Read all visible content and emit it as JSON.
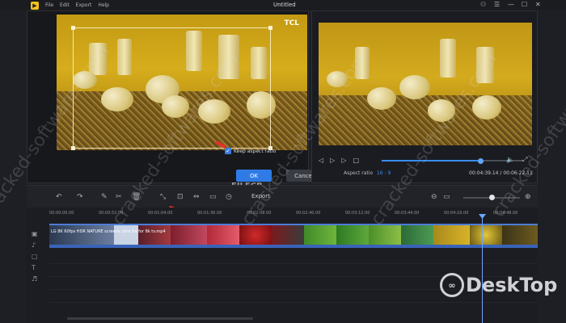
{
  "titlebar": {
    "menu": [
      "File",
      "Edit",
      "Export",
      "Help"
    ],
    "window_title": "Untitled",
    "controls": [
      "⚇",
      "☰",
      "—",
      "☐",
      "✕"
    ]
  },
  "crop_editor": {
    "image_badge": "TCL",
    "keep_aspect_label": "Keep aspect ratio",
    "keep_aspect_checked": true,
    "ok_label": "OK",
    "cancel_label": "Cancel"
  },
  "preview": {
    "controls": [
      "◁",
      "▷",
      "▷",
      "□"
    ],
    "aspect_label": "Aspect ratio",
    "aspect_value": "16 : 9",
    "time_readout": "00:04:39.14 / 00:06:22.11",
    "seek_progress": 0.7
  },
  "toolbar": {
    "tools": [
      "↶",
      "↷",
      "✎",
      "✂",
      "🗑",
      "⤡",
      "⊡",
      "⇔",
      "▭",
      "◷"
    ],
    "export_label": "Export",
    "zoom_level": 0.5
  },
  "timeline": {
    "ruler_ticks": [
      "00:00:00.00",
      "00:00:52.00",
      "00:01:04.00",
      "00:01:36.00",
      "00:02:08.00",
      "00:02:40.00",
      "00:03:12.00",
      "00:03:44.00",
      "00:04:16.00",
      "00:04:48.00"
    ],
    "clip_label": "LG 8K 60fps HDR NATURE screens ultra hd for 8k tv.mp4",
    "track_icons": [
      "▣",
      "♪",
      "▢",
      "T",
      "♬"
    ]
  },
  "watermarks": {
    "repeated_text": "cracked-softwares.com",
    "brand": "DeskTop",
    "filecr": "FILECR"
  }
}
